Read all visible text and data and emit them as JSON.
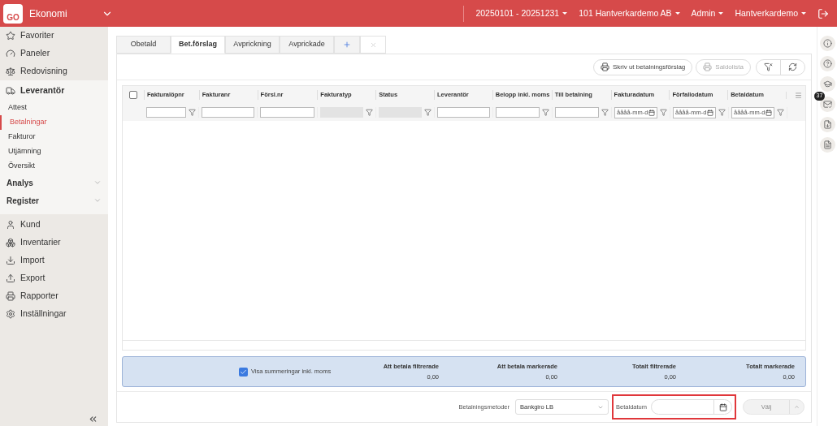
{
  "header": {
    "logo": "GO",
    "app_title": "Ekonomi",
    "menus": [
      {
        "label": "20250101 - 20251231"
      },
      {
        "label": "101 Hantverkardemo AB"
      },
      {
        "label": "Admin"
      },
      {
        "label": "Hantverkardemo"
      }
    ]
  },
  "sidebar": {
    "top_items": [
      {
        "label": "Favoriter"
      },
      {
        "label": "Paneler"
      },
      {
        "label": "Redovisning"
      }
    ],
    "section": {
      "label": "Leverantör",
      "children": [
        {
          "label": "Attest",
          "selected": false
        },
        {
          "label": "Betalningar",
          "selected": true
        },
        {
          "label": "Fakturor",
          "selected": false
        },
        {
          "label": "Utjämning",
          "selected": false
        },
        {
          "label": "Översikt",
          "selected": false
        }
      ]
    },
    "groups": [
      {
        "label": "Analys",
        "expanded": false
      },
      {
        "label": "Register",
        "expanded": false
      }
    ],
    "bottom_items": [
      {
        "label": "Kund"
      },
      {
        "label": "Inventarier"
      },
      {
        "label": "Import"
      },
      {
        "label": "Export"
      },
      {
        "label": "Rapporter"
      },
      {
        "label": "Inställningar"
      }
    ]
  },
  "tabs": [
    {
      "label": "Obetald",
      "selected": false
    },
    {
      "label": "Bet.förslag",
      "selected": true
    },
    {
      "label": "Avprickning",
      "selected": false
    },
    {
      "label": "Avprickade",
      "selected": false
    }
  ],
  "toolbar": [
    {
      "label": "Skriv ut betalningsförslag",
      "disabled": false
    },
    {
      "label": "Saldolista",
      "disabled": true
    }
  ],
  "table": {
    "select_all": {
      "checked": false
    },
    "columns": [
      {
        "label": "Fakturalöpnr",
        "kind": "text",
        "funnel": true
      },
      {
        "label": "Fakturanr",
        "kind": "text",
        "funnel": false
      },
      {
        "label": "Försl.nr",
        "kind": "text",
        "funnel": false
      },
      {
        "label": "Fakturatyp",
        "kind": "disabled",
        "funnel": true
      },
      {
        "label": "Status",
        "kind": "disabled",
        "funnel": true
      },
      {
        "label": "Leverantör",
        "kind": "text",
        "funnel": false
      },
      {
        "label": "Belopp inkl. moms",
        "kind": "text",
        "funnel": true
      },
      {
        "label": "Till betalning",
        "kind": "text",
        "funnel": true
      },
      {
        "label": "Fakturadatum",
        "kind": "date",
        "funnel": true,
        "placeholder": "åååå-mm-d"
      },
      {
        "label": "Förfallodatum",
        "kind": "date",
        "funnel": true,
        "placeholder": "åååå-mm-d"
      },
      {
        "label": "Betaldatum",
        "kind": "date",
        "funnel": true,
        "placeholder": "åååå-mm-d"
      }
    ]
  },
  "summary": {
    "checkbox": {
      "label": "Visa summeringar inkl. moms",
      "checked": true
    },
    "totals": [
      {
        "label": "Att betala filtrerade",
        "value": "0,00"
      },
      {
        "label": "Att betala markerade",
        "value": "0,00"
      },
      {
        "label": "Totalt filtrerade",
        "value": "0,00"
      },
      {
        "label": "Totalt markerade",
        "value": "0,00"
      }
    ]
  },
  "footer": {
    "payment_method": {
      "label": "Betalningsmetoder",
      "value": "Bankgiro LB"
    },
    "pay_date": {
      "label": "Betaldatum"
    },
    "choose_button": {
      "label": "Välj",
      "disabled": true
    }
  },
  "right_rail": {
    "badge": "37"
  }
}
